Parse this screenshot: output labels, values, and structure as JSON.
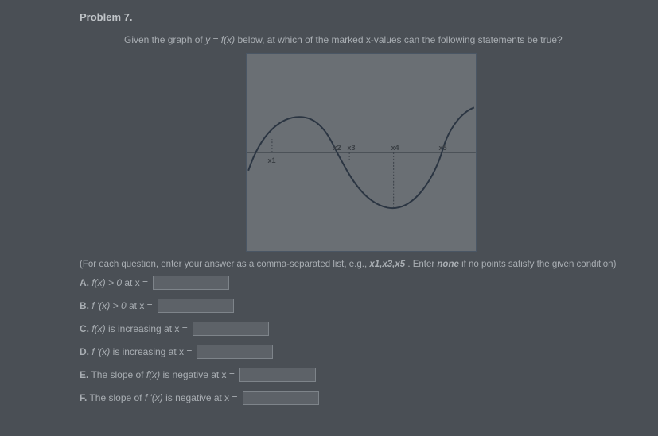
{
  "problem_number": "Problem 7.",
  "question_pre": "Given the graph of ",
  "question_eq": "y = f(x)",
  "question_post": " below, at which of the marked x-values can the following statements be true?",
  "graph": {
    "labels": [
      "x1",
      "x2",
      "x3",
      "x4",
      "x5"
    ]
  },
  "instruction_pre": "(For each question, enter your answer as a comma-separated list, e.g., ",
  "instruction_example": "x1,x3,x5",
  "instruction_mid": ". Enter ",
  "instruction_none": "none",
  "instruction_post": " if no points satisfy the given condition)",
  "parts": {
    "A": {
      "letter": "A.",
      "expr": "f(x) > 0",
      "suffix": " at x = "
    },
    "B": {
      "letter": "B.",
      "expr": "f '(x) > 0",
      "suffix": " at x = "
    },
    "C": {
      "letter": "C.",
      "expr": "f(x)",
      "mid": " is increasing at x = "
    },
    "D": {
      "letter": "D.",
      "expr": "f '(x)",
      "mid": " is increasing at x = "
    },
    "E": {
      "letter": "E.",
      "pre": "The slope of ",
      "expr": "f(x)",
      "mid": " is negative at x = "
    },
    "F": {
      "letter": "F.",
      "pre": "The slope of ",
      "expr": "f '(x)",
      "mid": " is negative at x = "
    }
  },
  "chart_data": {
    "type": "line",
    "title": "",
    "xlabel": "",
    "ylabel": "",
    "x_markers": [
      {
        "name": "x1",
        "x": 0.11,
        "y_sign": "below",
        "description": "on ascending branch, f>0 soon after; near zero-crossing going up"
      },
      {
        "name": "x2",
        "x": 0.39,
        "y_sign": "at_axis",
        "description": "zero-crossing descending"
      },
      {
        "name": "x3",
        "x": 0.45,
        "y_sign": "below",
        "description": "just below axis, descending"
      },
      {
        "name": "x4",
        "x": 0.64,
        "y_sign": "below",
        "description": "near local minimum / turning point"
      },
      {
        "name": "x5",
        "x": 0.85,
        "y_sign": "at_axis",
        "description": "zero-crossing ascending"
      }
    ],
    "curve_description": "smooth wave: starts below axis at left, rises to a local max above axis, descends through axis (x2,x3) to a local min below axis (near x4), rises back through axis (x5) and up to the right"
  }
}
